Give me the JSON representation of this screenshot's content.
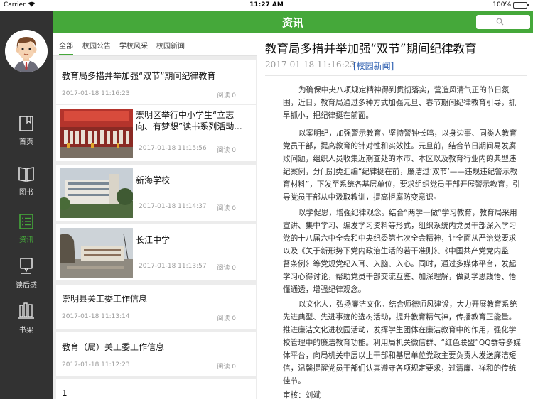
{
  "status_bar": {
    "carrier": "Carrier",
    "time": "11:27 AM",
    "battery": "100%"
  },
  "header": {
    "title": "资讯"
  },
  "sidebar": {
    "items": [
      {
        "label": "首页",
        "icon": "book-icon"
      },
      {
        "label": "图书",
        "icon": "open-book-icon"
      },
      {
        "label": "资讯",
        "icon": "news-list-icon",
        "active": true
      },
      {
        "label": "读后感",
        "icon": "reading-notes-icon"
      },
      {
        "label": "书架",
        "icon": "bookshelf-icon"
      }
    ]
  },
  "tabs": [
    "全部",
    "校园公告",
    "学校风采",
    "校园新闻"
  ],
  "news": [
    {
      "title": "教育局多措并举加强“双节”期间纪律教育",
      "date": "2017-01-18 11:16:23",
      "reads": "阅读 0"
    },
    {
      "title_lines": [
        "崇明区举行中小学生“立志",
        "向、有梦想”读书系列活动..."
      ],
      "date": "2017-01-18 11:15:56",
      "reads": "阅读 0"
    },
    {
      "title": "新海学校",
      "date": "2017-01-18 11:14:37",
      "reads": "阅读 0"
    },
    {
      "title": "长江中学",
      "date": "2017-01-18 11:13:57",
      "reads": "阅读 0"
    },
    {
      "title": "崇明县关工委工作信息",
      "date": "2017-01-18 11:13:14",
      "reads": "阅读 0"
    },
    {
      "title": "教育（局）关工委工作信息",
      "date": "2017-01-18 11:12:23",
      "reads": "阅读 0"
    },
    {
      "title": "1"
    }
  ],
  "article": {
    "title": "教育局多措并举加强“双节”期间纪律教育",
    "date": "2017-01-18 11:16:23",
    "category": "[校园新闻]",
    "paragraphs": [
      [
        "为确保中央八项规定精神得到贯彻落实，营造风清气正的节日氛",
        "围，近日，教育局通过多种方式加强元旦、春节期间纪律教育引导，抓",
        "早抓小，把纪律挺在前面。"
      ],
      [
        "以案明纪，加强警示教育。坚持警钟长鸣，以身边事、同类人教育",
        "党员干部，提高教育的针对性和实效性。元旦前，结合节日期间易发腐",
        "败问题，组织人员收集近期查处的本市、本区以及教育行业内的典型违",
        "纪案例，分门别类汇编“纪律挺在前，廉洁过‘双节’——违规违纪警示教",
        "育材料”，下发至系统各基层单位，要求组织党员干部开展警示教育，引",
        "导党员干部从中汲取教训，提高拒腐防变意识。"
      ],
      [
        "以学促思，增强纪律观念。结合“两学一做”学习教育，教育局采用",
        "宣讲、集中学习、编发学习资料等形式，组织系统内党员干部深入学习",
        "党的十八届六中全会和中央纪委第七次全会精神，让全面从严治党要求",
        "以及《关于新形势下党内政治生活的若干准则》、《中国共产党党内监",
        "督条例》等党规党纪入耳、入脑、入心。同时，通过多媒体平台，发起",
        "学习心得讨论，帮助党员干部交流互鉴、加深理解，做到学思践悟、悟",
        "懂通透，增强纪律观念。"
      ],
      [
        "以文化人，弘扬廉洁文化。结合师德师风建设，大力开展教育系统",
        "先进典型、先进事迹的选树活动，提升教育精气神，传播教育正能量。",
        "推进廉洁文化进校园活动，发挥学生团体在廉洁教育中的作用，强化学",
        "校管理中的廉洁教育功能。利用局机关微信群、“红色联盟”QQ群等多媒",
        "体平台，向局机关中层以上干部和基层单位党政主要负责人发送廉洁短",
        "信，温馨提醒党员干部们认真遵守各项规定要求，过清廉、祥和的传统",
        "佳节。"
      ]
    ],
    "auditor": "审核：刘斌"
  }
}
